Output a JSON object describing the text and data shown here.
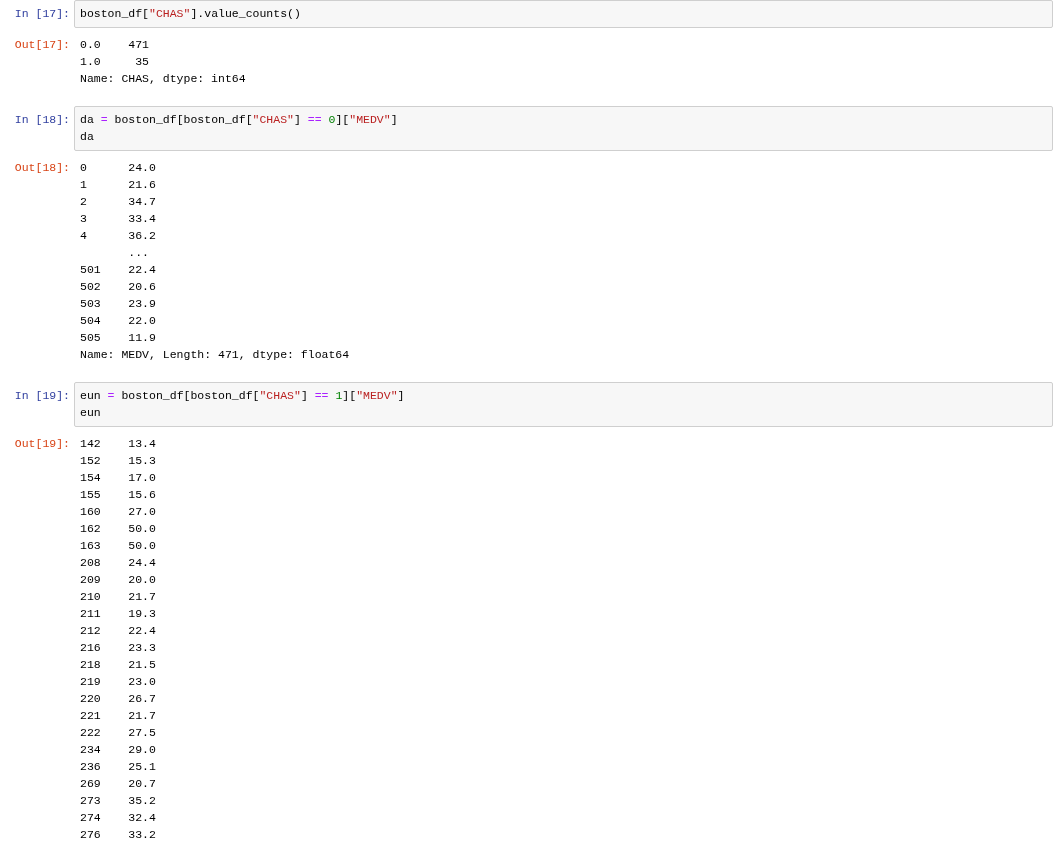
{
  "cells": [
    {
      "in_prompt": "In [17]:",
      "code": [
        [
          {
            "kind": "plain",
            "s": "boston_df["
          },
          {
            "kind": "string",
            "s": "\"CHAS\""
          },
          {
            "kind": "plain",
            "s": "].value_counts()"
          }
        ]
      ],
      "out_prompt": "Out[17]:",
      "output": [
        "0.0    471",
        "1.0     35",
        "Name: CHAS, dtype: int64"
      ]
    },
    {
      "in_prompt": "In [18]:",
      "code": [
        [
          {
            "kind": "plain",
            "s": "da "
          },
          {
            "kind": "operator",
            "s": "="
          },
          {
            "kind": "plain",
            "s": " boston_df[boston_df["
          },
          {
            "kind": "string",
            "s": "\"CHAS\""
          },
          {
            "kind": "plain",
            "s": "] "
          },
          {
            "kind": "operator",
            "s": "=="
          },
          {
            "kind": "number",
            "s": " 0"
          },
          {
            "kind": "plain",
            "s": "]["
          },
          {
            "kind": "string",
            "s": "\"MEDV\""
          },
          {
            "kind": "plain",
            "s": "]"
          }
        ],
        [
          {
            "kind": "plain",
            "s": "da"
          }
        ]
      ],
      "out_prompt": "Out[18]:",
      "output": [
        "0      24.0",
        "1      21.6",
        "2      34.7",
        "3      33.4",
        "4      36.2",
        "       ...",
        "501    22.4",
        "502    20.6",
        "503    23.9",
        "504    22.0",
        "505    11.9",
        "Name: MEDV, Length: 471, dtype: float64"
      ]
    },
    {
      "in_prompt": "In [19]:",
      "code": [
        [
          {
            "kind": "plain",
            "s": "eun "
          },
          {
            "kind": "operator",
            "s": "="
          },
          {
            "kind": "plain",
            "s": " boston_df[boston_df["
          },
          {
            "kind": "string",
            "s": "\"CHAS\""
          },
          {
            "kind": "plain",
            "s": "] "
          },
          {
            "kind": "operator",
            "s": "=="
          },
          {
            "kind": "number",
            "s": " 1"
          },
          {
            "kind": "plain",
            "s": "]["
          },
          {
            "kind": "string",
            "s": "\"MEDV\""
          },
          {
            "kind": "plain",
            "s": "]"
          }
        ],
        [
          {
            "kind": "plain",
            "s": "eun"
          }
        ]
      ],
      "out_prompt": "Out[19]:",
      "output": [
        "142    13.4",
        "152    15.3",
        "154    17.0",
        "155    15.6",
        "160    27.0",
        "162    50.0",
        "163    50.0",
        "208    24.4",
        "209    20.0",
        "210    21.7",
        "211    19.3",
        "212    22.4",
        "216    23.3",
        "218    21.5",
        "219    23.0",
        "220    26.7",
        "221    21.7",
        "222    27.5",
        "234    29.0",
        "236    25.1",
        "269    20.7",
        "273    35.2",
        "274    32.4",
        "276    33.2"
      ]
    }
  ]
}
